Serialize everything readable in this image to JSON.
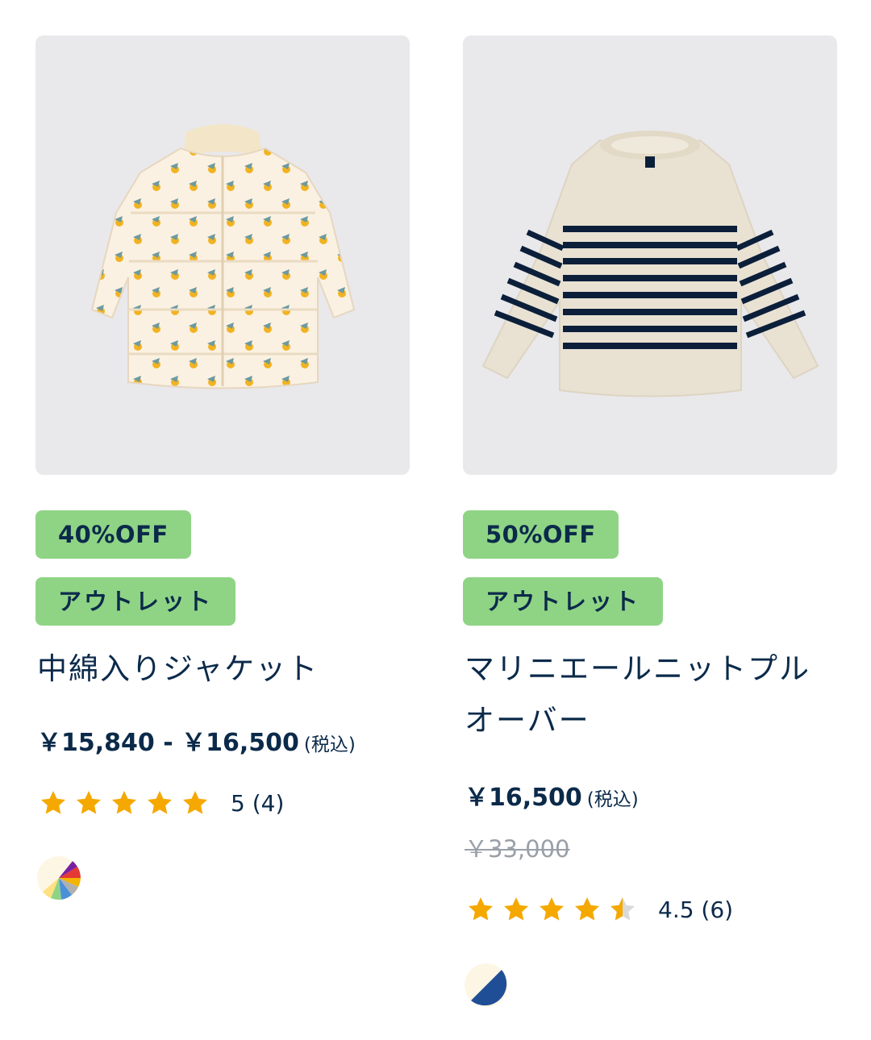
{
  "products": [
    {
      "image_alt": "中綿入りジャケット",
      "discount_label": "40%OFF",
      "outlet_label": "アウトレット",
      "name": "中綿入りジャケット",
      "price": "￥15,840 - ￥16,500",
      "tax_label": "(税込)",
      "rating": 5,
      "rating_text": "5 (4)",
      "swatch": "multicolor"
    },
    {
      "image_alt": "マリニエールニットプルオーバー",
      "discount_label": "50%OFF",
      "outlet_label": "アウトレット",
      "name": "マリニエールニットプルオーバー",
      "price": "￥16,500",
      "tax_label": "(税込)",
      "old_price": "￥33,000",
      "rating": 4.5,
      "rating_text": "4.5 (6)",
      "swatch": "white-navy"
    }
  ],
  "colors": {
    "tag_bg": "#8fd485",
    "text": "#0b2a4a",
    "star": "#f5a800",
    "star_empty": "#d9d9d9",
    "image_bg": "#e9e8eb"
  }
}
